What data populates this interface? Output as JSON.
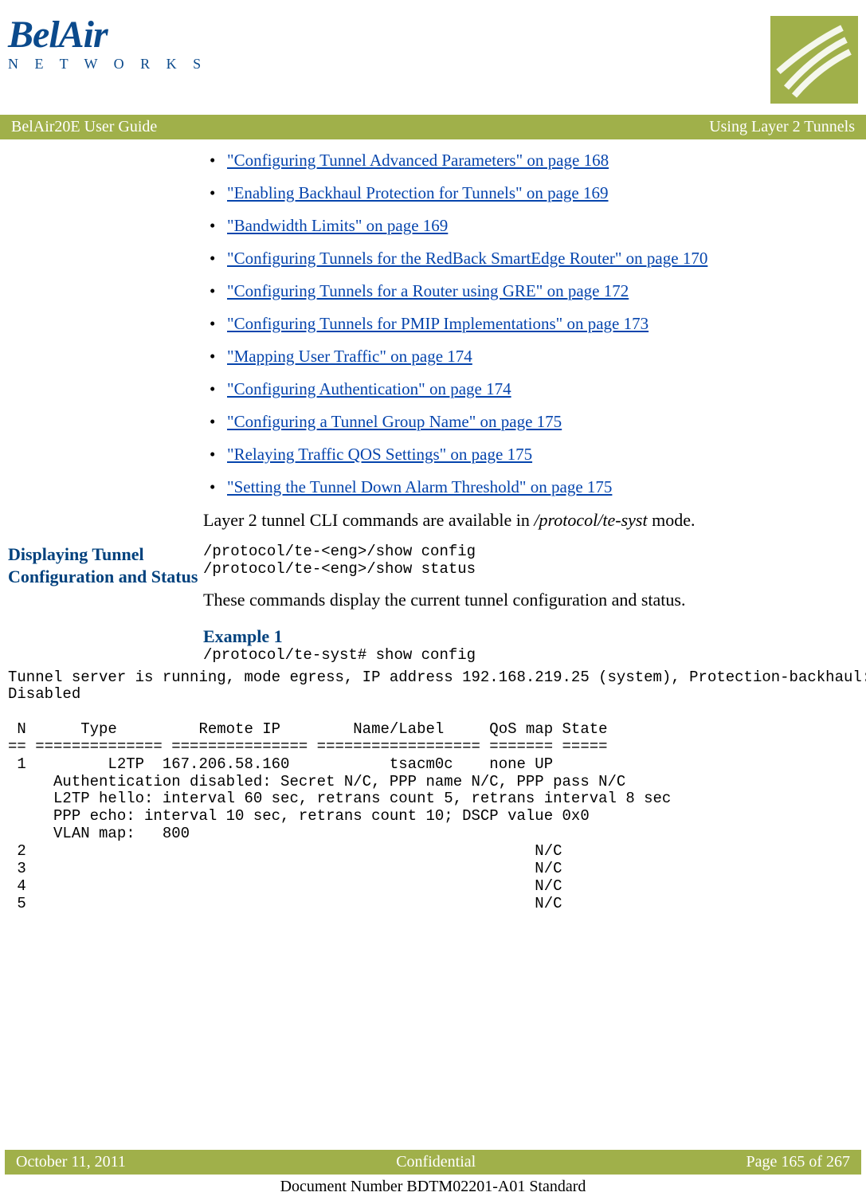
{
  "header": {
    "logo_main": "BelAir",
    "logo_sub": "N E T W O R K S",
    "left_bar": "BelAir20E User Guide",
    "right_bar": "Using Layer 2 Tunnels"
  },
  "links": [
    "\"Configuring Tunnel Advanced Parameters\" on page 168",
    "\"Enabling Backhaul Protection for Tunnels\" on page 169",
    "\"Bandwidth Limits\" on page 169",
    "\"Configuring Tunnels for the RedBack SmartEdge Router\" on page 170",
    "\"Configuring Tunnels for a Router using GRE\" on page 172",
    "\"Configuring Tunnels for PMIP Implementations\" on page 173",
    "\"Mapping User Traffic\" on page 174",
    "\"Configuring Authentication\" on page 174",
    "\"Configuring a Tunnel Group Name\" on page 175",
    "\"Relaying Traffic QOS Settings\" on page 175",
    "\"Setting the Tunnel Down Alarm Threshold\" on page 175"
  ],
  "body": {
    "cli_note_pre": "Layer 2 tunnel CLI commands are available in ",
    "cli_note_italic": "/protocol/te-syst",
    "cli_note_post": " mode.",
    "side_heading": "Displaying Tunnel Configuration and Status",
    "cmd1": "/protocol/te-<eng>/show config",
    "cmd2": "/protocol/te-<eng>/show status",
    "desc": "These commands display the current tunnel configuration and status.",
    "example_label": "Example 1",
    "example_cmd": "/protocol/te-syst# show config"
  },
  "terminal": "Tunnel server is running, mode egress, IP address 192.168.219.25 (system), Protection-backhaul: \nDisabled\n\n N      Type         Remote IP        Name/Label     QoS map State\n== ============== =============== ================== ======= =====\n 1         L2TP  167.206.58.160           tsacm0c    none UP\n     Authentication disabled: Secret N/C, PPP name N/C, PPP pass N/C\n     L2TP hello: interval 60 sec, retrans count 5, retrans interval 8 sec\n     PPP echo: interval 10 sec, retrans count 10; DSCP value 0x0\n     VLAN map:   800\n 2                                                        N/C\n 3                                                        N/C\n 4                                                        N/C\n 5                                                        N/C",
  "footer": {
    "left": "October 11, 2011",
    "center": "Confidential",
    "right": "Page 165 of 267",
    "doc": "Document Number BDTM02201-A01 Standard"
  }
}
